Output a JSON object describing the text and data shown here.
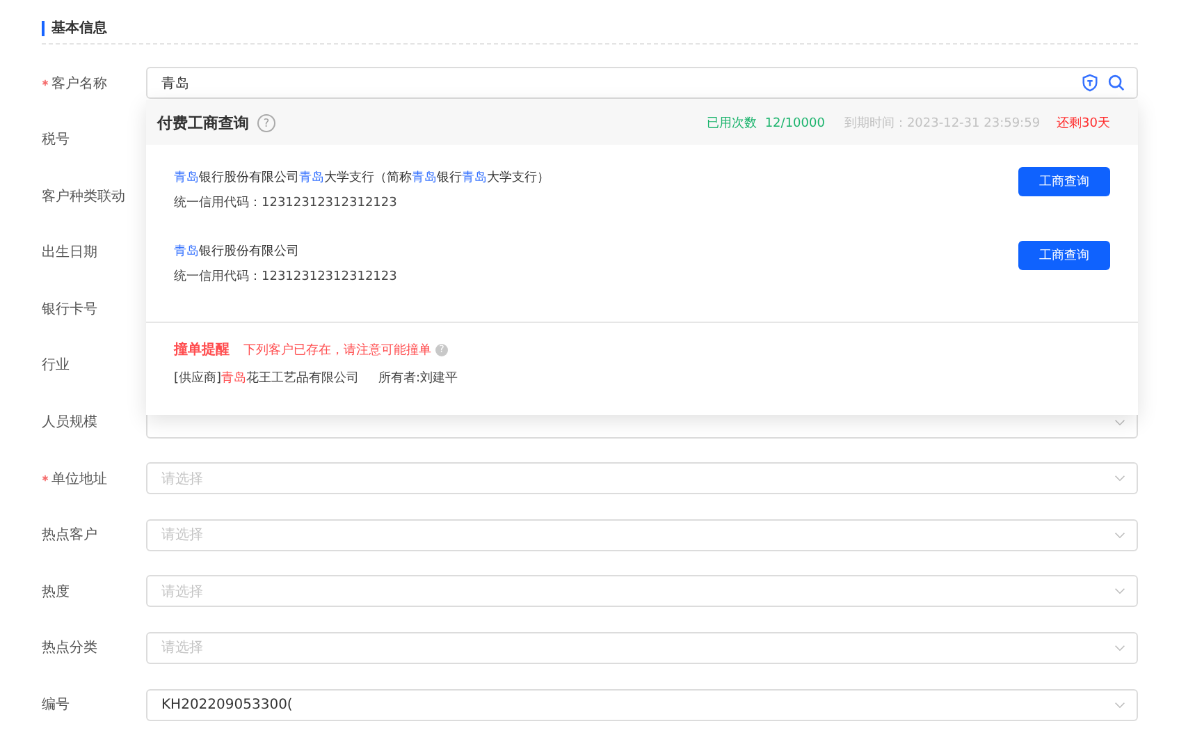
{
  "section": {
    "title": "基本信息"
  },
  "rows": [
    {
      "label": "客户名称",
      "required": true,
      "kind": "search",
      "value": "青岛"
    },
    {
      "label": "税号",
      "required": false,
      "kind": "hidden"
    },
    {
      "label": "客户种类联动",
      "required": false,
      "kind": "hidden"
    },
    {
      "label": "出生日期",
      "required": false,
      "kind": "hidden"
    },
    {
      "label": "银行卡号",
      "required": false,
      "kind": "hidden"
    },
    {
      "label": "行业",
      "required": false,
      "kind": "hidden"
    },
    {
      "label": "人员规模",
      "required": false,
      "kind": "select"
    },
    {
      "label": "单位地址",
      "required": true,
      "kind": "select",
      "placeholder": "请选择"
    },
    {
      "label": "热点客户",
      "required": false,
      "kind": "select",
      "placeholder": "请选择"
    },
    {
      "label": "热度",
      "required": false,
      "kind": "select",
      "placeholder": "请选择"
    },
    {
      "label": "热点分类",
      "required": false,
      "kind": "select",
      "placeholder": "请选择"
    },
    {
      "label": "编号",
      "required": false,
      "kind": "select",
      "value": "KH202209053300("
    }
  ],
  "popup": {
    "title": "付费工商查询",
    "help": "?",
    "used_label": "已用次数",
    "used_value": "12/10000",
    "expiry": "到期时间：2023-12-31 23:59:59",
    "remaining": "还剩30天",
    "results": [
      {
        "name": [
          {
            "text": "青岛",
            "highlight": true
          },
          {
            "text": "银行股份有限公司",
            "highlight": false
          },
          {
            "text": "青岛",
            "highlight": true
          },
          {
            "text": "大学支行（简称",
            "highlight": false
          },
          {
            "text": "青岛",
            "highlight": true
          },
          {
            "text": "银行",
            "highlight": false
          },
          {
            "text": "青岛",
            "highlight": true
          },
          {
            "text": "大学支行）",
            "highlight": false
          }
        ],
        "code": "统一信用代码：12312312312312123",
        "button": "工商查询"
      },
      {
        "name": [
          {
            "text": "青岛",
            "highlight": true
          },
          {
            "text": "银行股份有限公司",
            "highlight": false
          }
        ],
        "code": "统一信用代码：12312312312312123",
        "button": "工商查询"
      }
    ],
    "warning": {
      "title": "撞单提醒",
      "message": "下列客户已存在，请注意可能撞单",
      "help": "?",
      "customer": [
        {
          "text": "[供应商]",
          "highlight": false
        },
        {
          "text": "青岛",
          "highlight": true
        },
        {
          "text": "花王工艺品有限公司",
          "highlight": false
        }
      ],
      "owner": "所有者:刘建平"
    }
  }
}
